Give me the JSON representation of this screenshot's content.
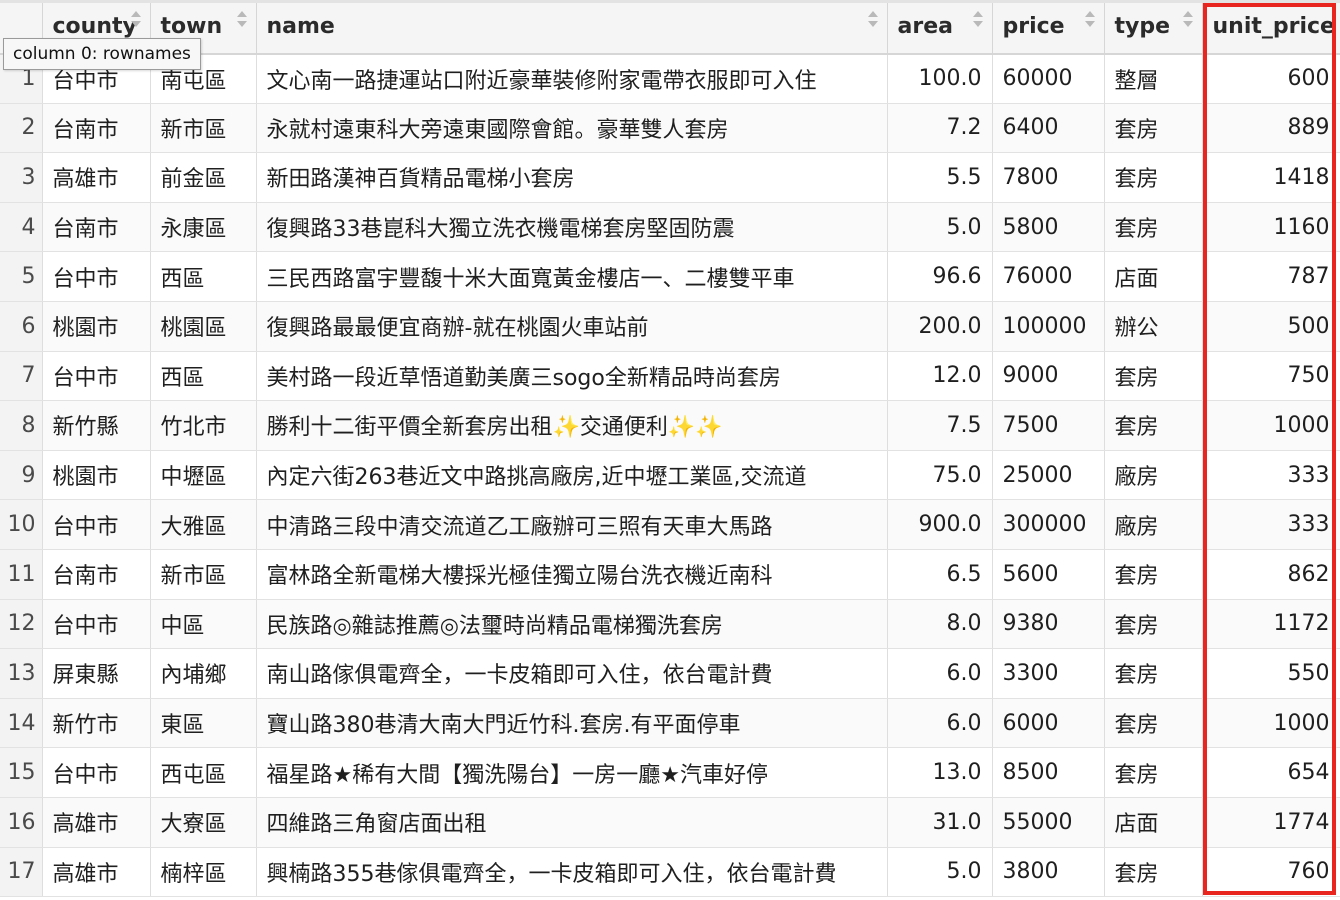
{
  "columns": [
    {
      "key": "rownames",
      "label": ""
    },
    {
      "key": "county",
      "label": "county"
    },
    {
      "key": "town",
      "label": "town"
    },
    {
      "key": "name",
      "label": "name"
    },
    {
      "key": "area",
      "label": "area"
    },
    {
      "key": "price",
      "label": "price"
    },
    {
      "key": "type",
      "label": "type"
    },
    {
      "key": "unit_price",
      "label": "unit_price"
    }
  ],
  "tooltip": "column 0: rownames",
  "highlight_color": "#e8261f",
  "rows": [
    {
      "rn": "1",
      "county": "台中市",
      "town": "南屯區",
      "name": "文心南一路捷運站口附近豪華裝修附家電帶衣服即可入住",
      "area": "100.0",
      "price": "60000",
      "type": "整層",
      "unit_price": "600"
    },
    {
      "rn": "2",
      "county": "台南市",
      "town": "新市區",
      "name": "永就村遠東科大旁遠東國際會館。豪華雙人套房",
      "area": "7.2",
      "price": "6400",
      "type": "套房",
      "unit_price": "889"
    },
    {
      "rn": "3",
      "county": "高雄市",
      "town": "前金區",
      "name": "新田路漢神百貨精品電梯小套房",
      "area": "5.5",
      "price": "7800",
      "type": "套房",
      "unit_price": "1418"
    },
    {
      "rn": "4",
      "county": "台南市",
      "town": "永康區",
      "name": "復興路33巷崑科大獨立洗衣機電梯套房堅固防震",
      "area": "5.0",
      "price": "5800",
      "type": "套房",
      "unit_price": "1160"
    },
    {
      "rn": "5",
      "county": "台中市",
      "town": "西區",
      "name": "三民西路富宇豐馥十米大面寬黃金樓店一、二樓雙平車",
      "area": "96.6",
      "price": "76000",
      "type": "店面",
      "unit_price": "787"
    },
    {
      "rn": "6",
      "county": "桃園市",
      "town": "桃園區",
      "name": "復興路最最便宜商辦-就在桃園火車站前",
      "area": "200.0",
      "price": "100000",
      "type": "辦公",
      "unit_price": "500"
    },
    {
      "rn": "7",
      "county": "台中市",
      "town": "西區",
      "name": "美村路一段近草悟道勤美廣三sogo全新精品時尚套房",
      "area": "12.0",
      "price": "9000",
      "type": "套房",
      "unit_price": "750"
    },
    {
      "rn": "8",
      "county": "新竹縣",
      "town": "竹北市",
      "name": "勝利十二街平價全新套房出租✨交通便利✨✨",
      "area": "7.5",
      "price": "7500",
      "type": "套房",
      "unit_price": "1000"
    },
    {
      "rn": "9",
      "county": "桃園市",
      "town": "中壢區",
      "name": "內定六街263巷近文中路挑高廠房,近中壢工業區,交流道",
      "area": "75.0",
      "price": "25000",
      "type": "廠房",
      "unit_price": "333"
    },
    {
      "rn": "10",
      "county": "台中市",
      "town": "大雅區",
      "name": "中清路三段中清交流道乙工廠辦可三照有天車大馬路",
      "area": "900.0",
      "price": "300000",
      "type": "廠房",
      "unit_price": "333"
    },
    {
      "rn": "11",
      "county": "台南市",
      "town": "新市區",
      "name": "富林路全新電梯大樓採光極佳獨立陽台洗衣機近南科",
      "area": "6.5",
      "price": "5600",
      "type": "套房",
      "unit_price": "862"
    },
    {
      "rn": "12",
      "county": "台中市",
      "town": "中區",
      "name": "民族路◎雜誌推薦◎法璽時尚精品電梯獨洗套房",
      "area": "8.0",
      "price": "9380",
      "type": "套房",
      "unit_price": "1172"
    },
    {
      "rn": "13",
      "county": "屏東縣",
      "town": "內埔鄉",
      "name": "南山路傢俱電齊全，一卡皮箱即可入住，依台電計費",
      "area": "6.0",
      "price": "3300",
      "type": "套房",
      "unit_price": "550"
    },
    {
      "rn": "14",
      "county": "新竹市",
      "town": "東區",
      "name": "寶山路380巷清大南大門近竹科.套房.有平面停車",
      "area": "6.0",
      "price": "6000",
      "type": "套房",
      "unit_price": "1000"
    },
    {
      "rn": "15",
      "county": "台中市",
      "town": "西屯區",
      "name": "福星路★稀有大間【獨洗陽台】一房一廳★汽車好停",
      "area": "13.0",
      "price": "8500",
      "type": "套房",
      "unit_price": "654"
    },
    {
      "rn": "16",
      "county": "高雄市",
      "town": "大寮區",
      "name": "四維路三角窗店面出租",
      "area": "31.0",
      "price": "55000",
      "type": "店面",
      "unit_price": "1774"
    },
    {
      "rn": "17",
      "county": "高雄市",
      "town": "楠梓區",
      "name": "興楠路355巷傢俱電齊全，一卡皮箱即可入住，依台電計費",
      "area": "5.0",
      "price": "3800",
      "type": "套房",
      "unit_price": "760"
    }
  ]
}
